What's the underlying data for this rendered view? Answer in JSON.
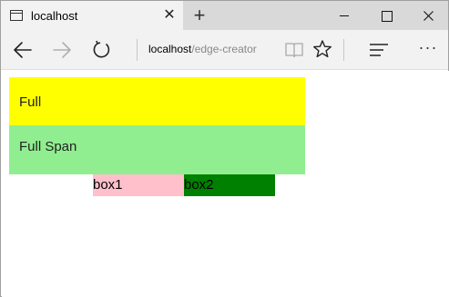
{
  "browser": {
    "tab_title": "localhost",
    "tab_close_glyph": "✕",
    "new_tab_glyph": "+",
    "more_glyph": "···",
    "address_host": "localhost",
    "address_path": "/edge-creator"
  },
  "icons": [
    "page-icon",
    "close-icon",
    "plus-icon",
    "minimize-icon",
    "maximize-icon",
    "window-close-icon",
    "back-arrow-icon",
    "forward-arrow-icon",
    "refresh-icon",
    "reading-view-icon",
    "favorite-star-icon",
    "hub-icon",
    "more-icon"
  ],
  "page": {
    "full_label": "Full",
    "full_span_label": "Full Span",
    "box1_label": "box1",
    "box2_label": "box2"
  },
  "colors": {
    "full": "#ffff00",
    "full_span": "#90ee90",
    "box1": "#ffc0cb",
    "box2": "#008000"
  }
}
